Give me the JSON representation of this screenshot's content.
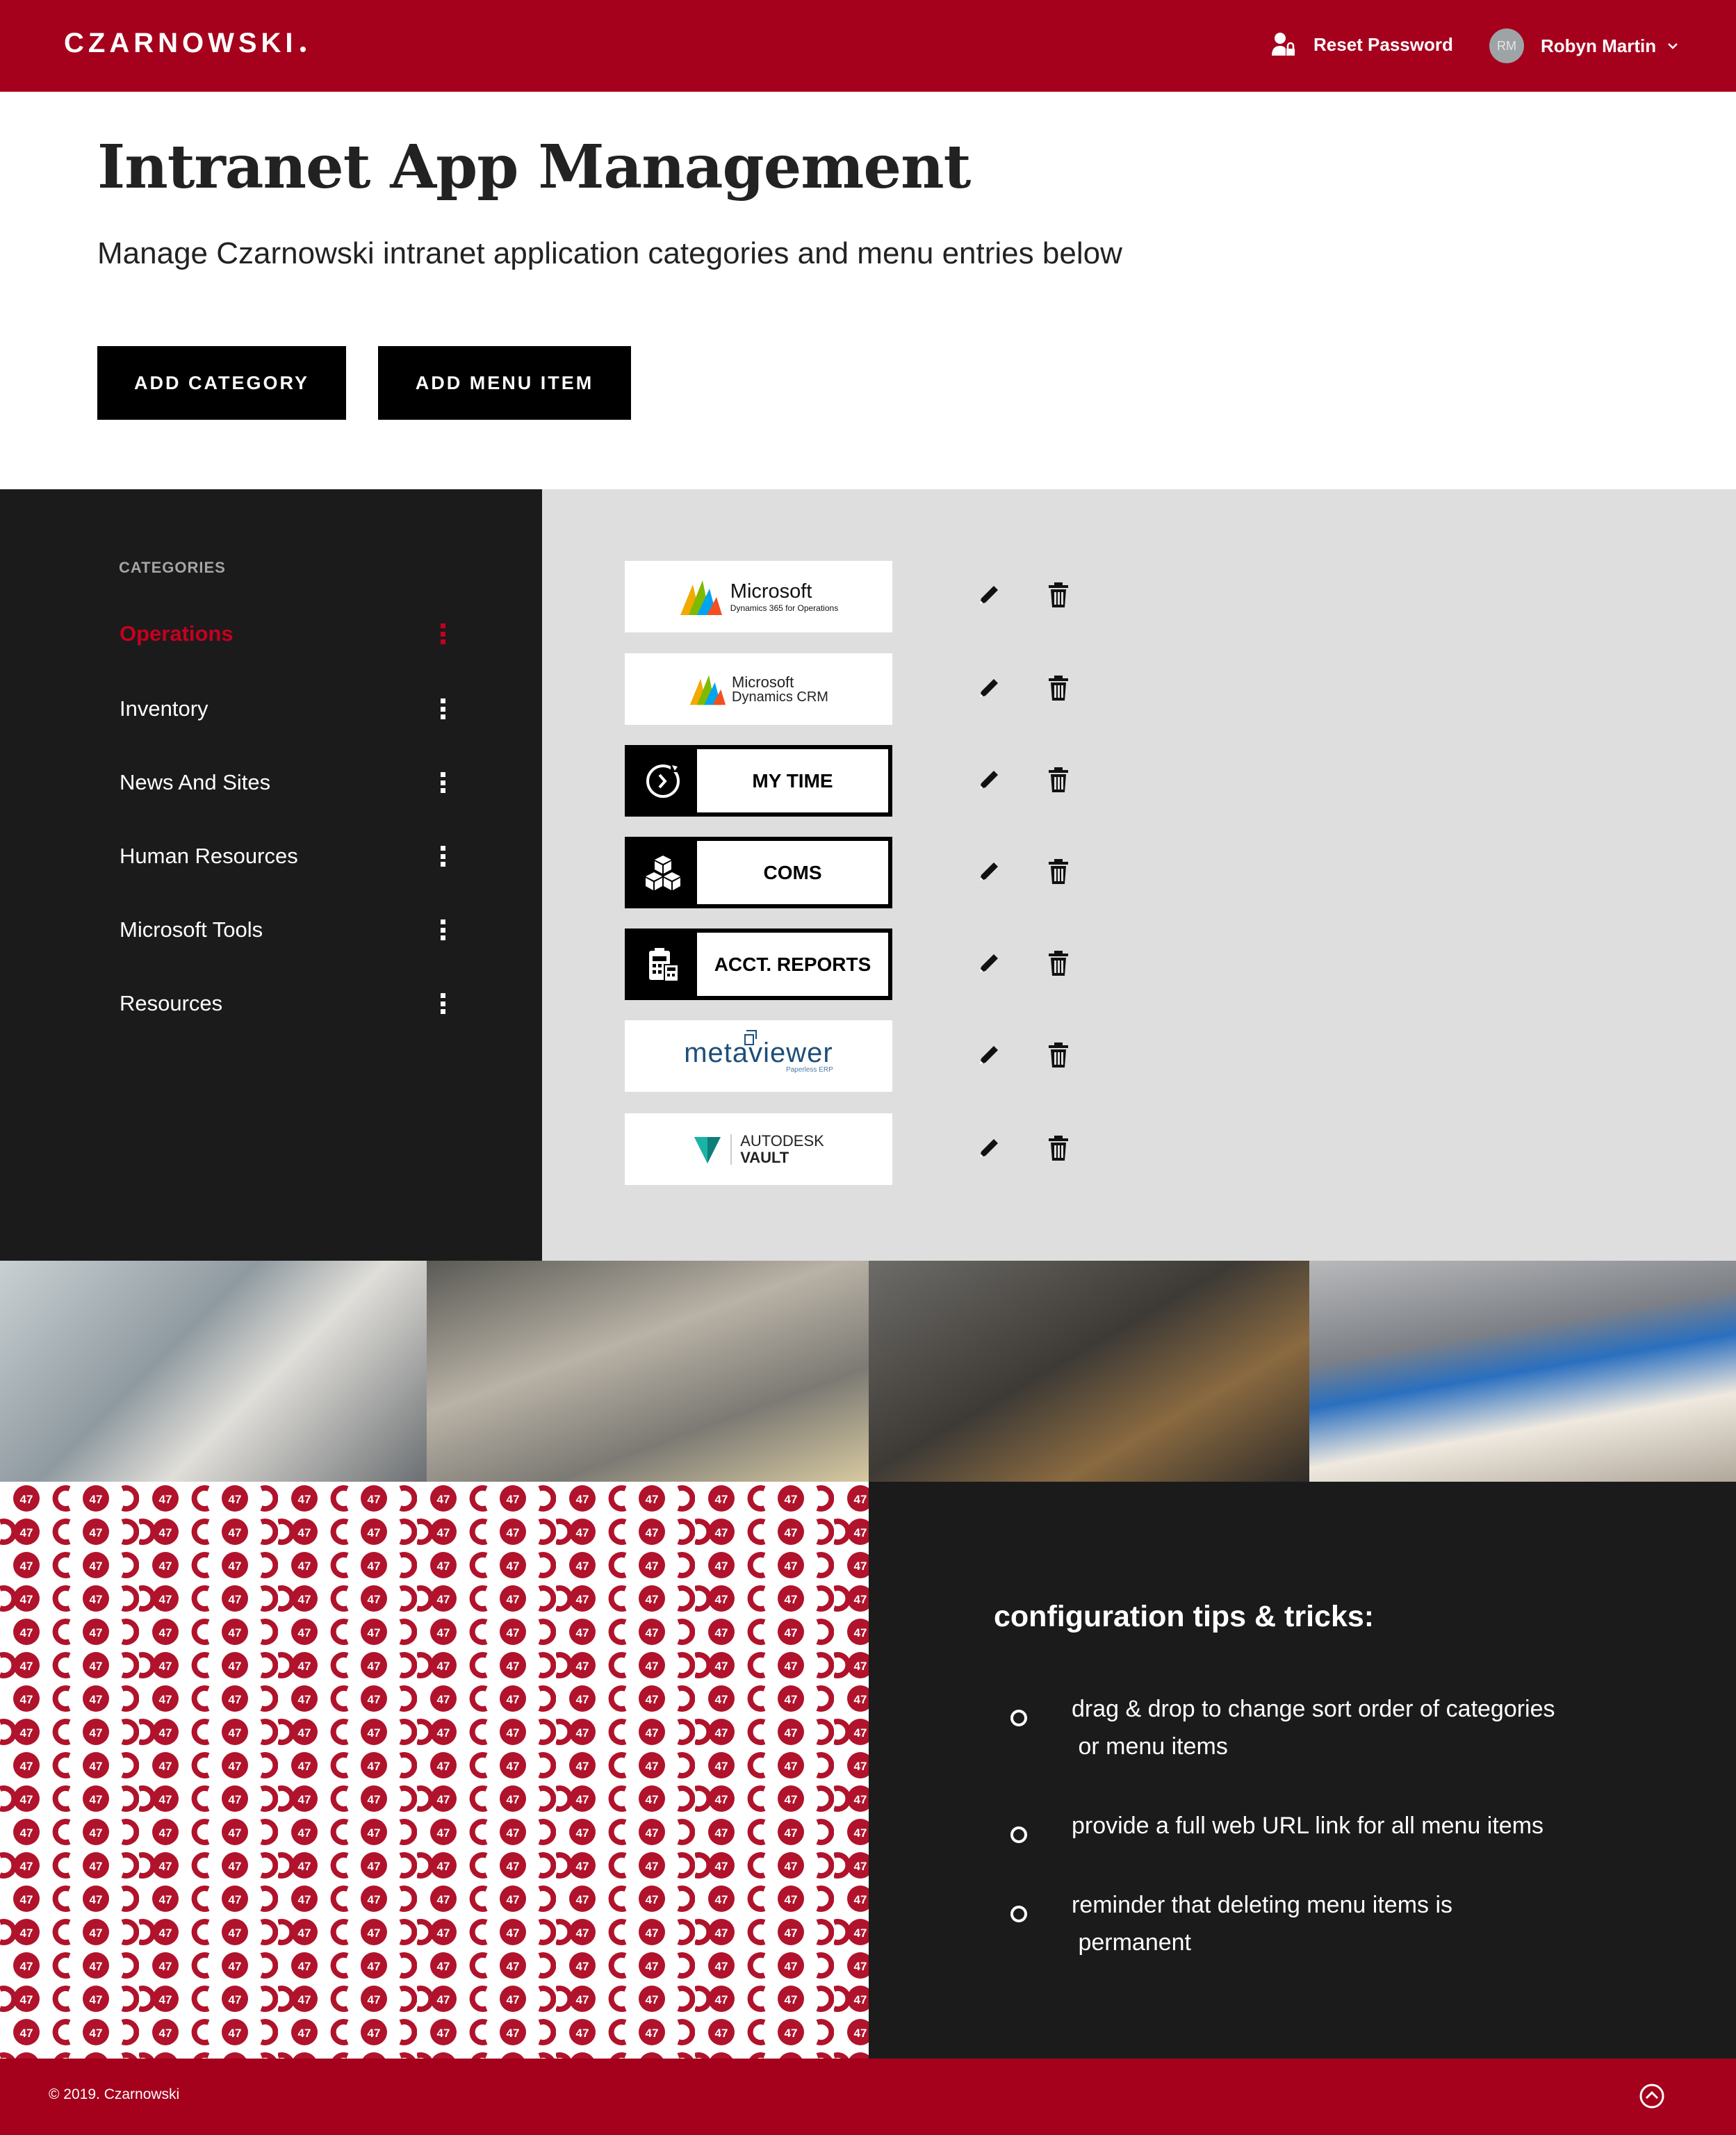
{
  "header": {
    "logo": "CZARNOWSKI",
    "reset_password": "Reset Password",
    "avatar_initials": "RM",
    "user_name": "Robyn Martin",
    "accent_color": "#a5001c"
  },
  "hero": {
    "title": "Intranet App Management",
    "subtitle": "Manage Czarnowski intranet application categories and menu entries below",
    "add_category": "ADD CATEGORY",
    "add_menu_item": "ADD MENU ITEM"
  },
  "sidebar": {
    "heading": "CATEGORIES",
    "items": [
      {
        "label": "Operations",
        "active": true
      },
      {
        "label": "Inventory"
      },
      {
        "label": "News And Sites"
      },
      {
        "label": "Human Resources"
      },
      {
        "label": "Microsoft Tools"
      },
      {
        "label": "Resources"
      }
    ]
  },
  "apps": [
    {
      "name": "Microsoft",
      "sub": "Dynamics 365 for Operations",
      "icon": "microsoft-dynamics-logo"
    },
    {
      "name": "Microsoft",
      "sub": "Dynamics CRM",
      "icon": "microsoft-dynamics-logo"
    },
    {
      "name": "MY TIME",
      "icon": "clock-icon"
    },
    {
      "name": "COMS",
      "icon": "boxes-icon"
    },
    {
      "name": "ACCT. REPORTS",
      "icon": "calculator-icon"
    },
    {
      "name": "metaviewer",
      "sub": "Paperless ERP",
      "icon": "metaviewer-logo"
    },
    {
      "name": "AUTODESK",
      "sub": "VAULT",
      "icon": "autodesk-logo"
    }
  ],
  "tips": {
    "title": "configuration tips & tricks:",
    "items": [
      {
        "line1": "drag & drop to change sort order of categories",
        "line2": " or menu items"
      },
      {
        "line1": "provide a full web URL link for all menu items",
        "line2": ""
      },
      {
        "line1": "reminder that deleting menu items is",
        "line2": " permanent"
      }
    ]
  },
  "footer": {
    "copyright": "© 2019. Czarnowski"
  }
}
